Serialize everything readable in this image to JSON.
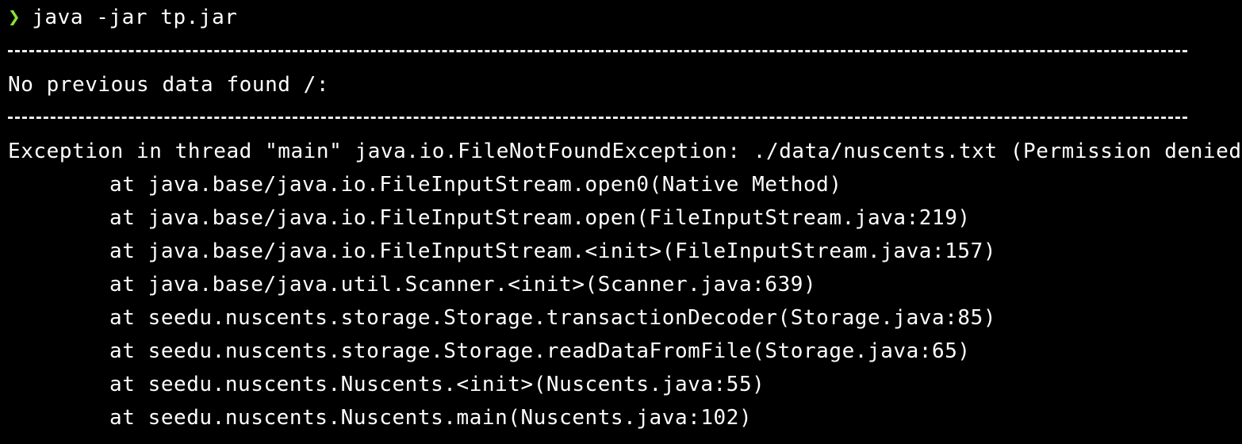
{
  "terminal": {
    "prompt_symbol": "❯",
    "command": "java -jar tp.jar",
    "message": "No previous data found /:",
    "exception": "Exception in thread \"main\" java.io.FileNotFoundException: ./data/nuscents.txt (Permission denied)",
    "stack_trace": [
      "at java.base/java.io.FileInputStream.open0(Native Method)",
      "at java.base/java.io.FileInputStream.open(FileInputStream.java:219)",
      "at java.base/java.io.FileInputStream.<init>(FileInputStream.java:157)",
      "at java.base/java.util.Scanner.<init>(Scanner.java:639)",
      "at seedu.nuscents.storage.Storage.transactionDecoder(Storage.java:85)",
      "at seedu.nuscents.storage.Storage.readDataFromFile(Storage.java:65)",
      "at seedu.nuscents.Nuscents.<init>(Nuscents.java:55)",
      "at seedu.nuscents.Nuscents.main(Nuscents.java:102)"
    ]
  },
  "colors": {
    "background": "#000000",
    "text": "#ffffff",
    "prompt": "#8ae234"
  }
}
